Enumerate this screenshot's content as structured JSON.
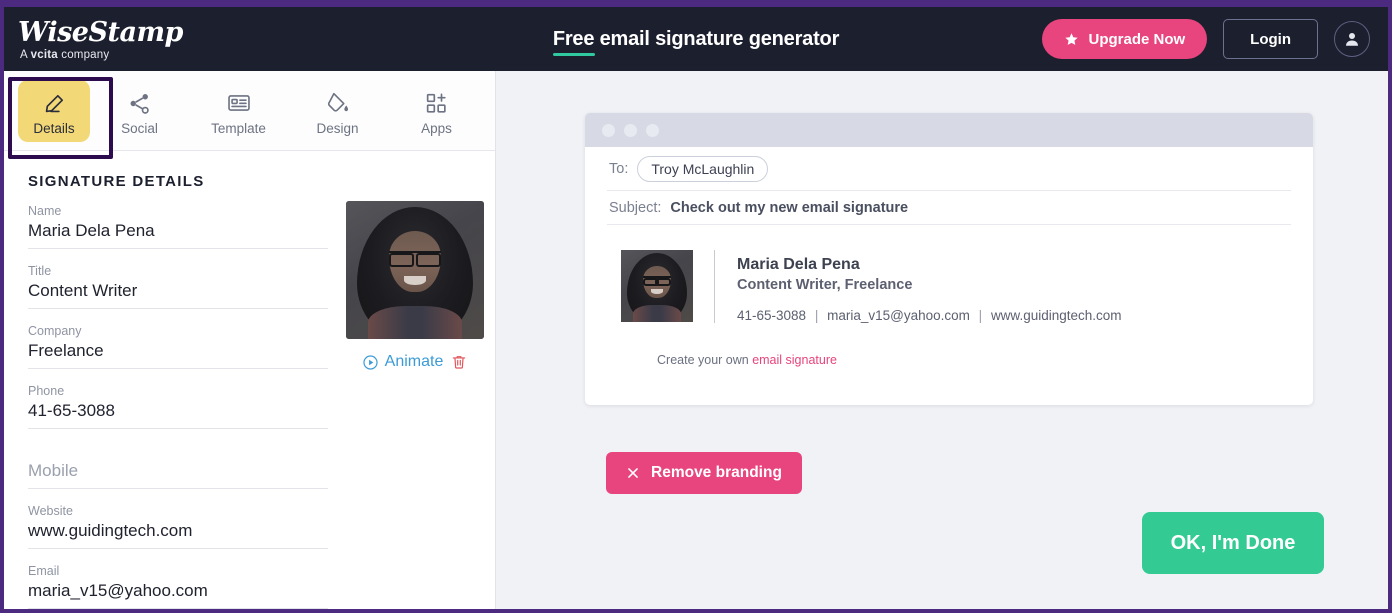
{
  "header": {
    "logo_word": "WiseStamp",
    "logo_sub_prefix": "A ",
    "logo_sub_brand": "vcita",
    "logo_sub_suffix": " company",
    "title": "Free email signature generator",
    "upgrade_label": "Upgrade Now",
    "login_label": "Login",
    "accent_pink": "#e8447d",
    "accent_green": "#31c9a0",
    "bar_background": "#1c1f2e"
  },
  "tabs": [
    {
      "label": "Details",
      "icon": "pencil-icon",
      "active": true
    },
    {
      "label": "Social",
      "icon": "share-icon",
      "active": false
    },
    {
      "label": "Template",
      "icon": "id-card-icon",
      "active": false
    },
    {
      "label": "Design",
      "icon": "paint-bucket-icon",
      "active": false
    },
    {
      "label": "Apps",
      "icon": "grid-plus-icon",
      "active": false
    }
  ],
  "details_panel": {
    "section_title": "SIGNATURE DETAILS",
    "fields": [
      {
        "label": "Name",
        "value": "Maria Dela Pena",
        "placeholder": ""
      },
      {
        "label": "Title",
        "value": "Content Writer",
        "placeholder": ""
      },
      {
        "label": "Company",
        "value": "Freelance",
        "placeholder": ""
      },
      {
        "label": "Phone",
        "value": "41-65-3088",
        "placeholder": ""
      },
      {
        "label": "",
        "value": "",
        "placeholder": "Mobile"
      },
      {
        "label": "Website",
        "value": "www.guidingtech.com",
        "placeholder": ""
      },
      {
        "label": "Email",
        "value": "maria_v15@yahoo.com",
        "placeholder": ""
      }
    ],
    "photo": {
      "alt": "profile-photo-maria-dela-pena",
      "animate_label": "Animate",
      "delete_label": "delete"
    }
  },
  "preview": {
    "to_label": "To:",
    "to_value": "Troy McLaughlin",
    "subject_label": "Subject:",
    "subject_value": "Check out my new email signature",
    "signature": {
      "name": "Maria Dela Pena",
      "title": "Content Writer, Freelance",
      "phone": "41-65-3088",
      "email": "maria_v15@yahoo.com",
      "website": "www.guidingtech.com",
      "separator": "|"
    },
    "branding_prefix": "Create your own ",
    "branding_link": "email signature",
    "remove_branding_label": "Remove branding",
    "done_label": "OK, I'm Done"
  }
}
